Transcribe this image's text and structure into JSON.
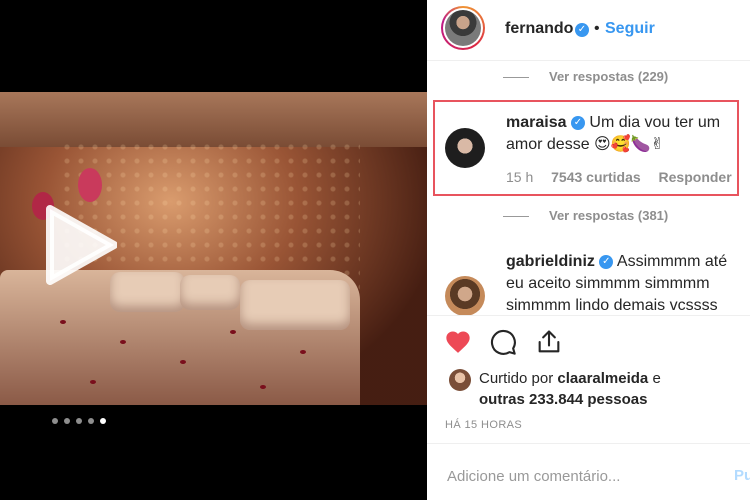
{
  "header": {
    "username": "fernando",
    "separator": "•",
    "follow_label": "Seguir"
  },
  "media": {
    "carousel_pages": 5,
    "active_page": 5
  },
  "comments": [
    {
      "view_replies": "Ver respostas (229)"
    },
    {
      "username": "maraisa",
      "text": "Um dia vou ter um amor desse 😍🥰🍆✌",
      "time": "15 h",
      "likes": "7543 curtidas",
      "reply": "Responder",
      "view_replies": "Ver respostas (381)"
    },
    {
      "username": "gabrieldiniz",
      "text": "Assimmmm até eu aceito simmmm simmmm simmmm lindo demais vcssss"
    }
  ],
  "likes": {
    "prefix": "Curtido por",
    "user": "claaralmeida",
    "and": "e",
    "others": "outras 233.844 pessoas"
  },
  "timestamp": "HÁ 15 HORAS",
  "add_comment": {
    "placeholder": "Adicione um comentário...",
    "post_label": "Pu"
  },
  "icons": {
    "like": "heart-icon",
    "comment": "comment-icon",
    "share": "share-icon",
    "play": "play-icon",
    "verified": "verified-badge-icon"
  },
  "colors": {
    "accent": "#3897f0",
    "like": "#ed4956",
    "highlight": "#e8545e"
  }
}
